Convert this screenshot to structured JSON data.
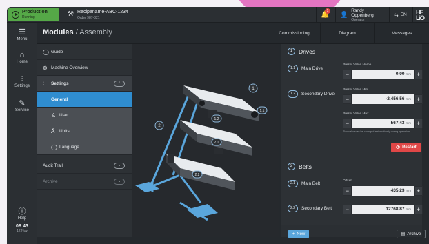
{
  "status": {
    "title": "Production",
    "state": "Running"
  },
  "recipe": {
    "name": "Recipename-ABC-1234",
    "order": "Order 987-321"
  },
  "notifications": {
    "count": "1"
  },
  "user": {
    "name": "Randy Oppenberg",
    "role": "Operator"
  },
  "language": "EN",
  "logo": "HE LiO",
  "sidebar": {
    "menu": "Menu",
    "home": "Home",
    "settings": "Settings",
    "service": "Service",
    "help": "Help",
    "time": "08:43",
    "date": "12 Nov"
  },
  "header": {
    "title": "Modules",
    "subtitle": "/ Assembly",
    "tabs": [
      "Commissioning",
      "Diagram",
      "Messages"
    ]
  },
  "nav": {
    "guide": "Guide",
    "machine_overview": "Machine Overview",
    "settings": "Settings",
    "general": "General",
    "user": "User",
    "units": "Units",
    "language": "Language",
    "audit_trail": "Audit Trail",
    "archive": "Archive"
  },
  "viewer": {
    "callouts": [
      "1",
      "1.1",
      "1.2",
      "2",
      "2.1",
      "2.2"
    ]
  },
  "drives": {
    "num": "1",
    "title": "Drives",
    "main": {
      "num": "1.1",
      "label": "Main Drive",
      "field": "Preset Value Home",
      "value": "0.00",
      "unit": "mm"
    },
    "secondary": {
      "num": "1.2",
      "label": "Secondary Drive",
      "min_field": "Preset Value Min",
      "min_value": "-2,456.56",
      "min_unit": "mm",
      "max_field": "Preset Value Max",
      "max_value": "567.43",
      "max_unit": "mm",
      "hint": "This value can be changed automatically during operation"
    },
    "restart": "Restart"
  },
  "belts": {
    "num": "2",
    "title": "Belts",
    "main": {
      "num": "2.1",
      "label": "Main Belt",
      "field": "Offset",
      "value": "435.23",
      "unit": "mm"
    },
    "secondary": {
      "num": "2.2",
      "label": "Secondary Belt",
      "value": "12768.87",
      "unit": "mm"
    }
  },
  "footer": {
    "new": "New",
    "archive": "Archive"
  }
}
